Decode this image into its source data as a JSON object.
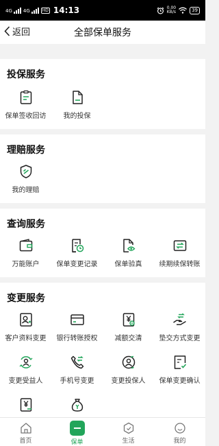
{
  "status_bar": {
    "signal1": "4G",
    "signal2": "4G",
    "hd": "HD",
    "time": "14:13",
    "speed": "0.00",
    "speed_unit": "KB/s",
    "battery": "39"
  },
  "nav": {
    "back_label": "返回",
    "title": "全部保单服务"
  },
  "sections": [
    {
      "title": "投保服务",
      "items": [
        {
          "label": "保单签收回访",
          "icon": "clipboard-icon"
        },
        {
          "label": "我的投保",
          "icon": "document-icon"
        }
      ]
    },
    {
      "title": "理赔服务",
      "items": [
        {
          "label": "我的理赔",
          "icon": "claim-shield-icon"
        }
      ]
    },
    {
      "title": "查询服务",
      "items": [
        {
          "label": "万能账户",
          "icon": "wallet-icon"
        },
        {
          "label": "保单变更记录",
          "icon": "record-clock-icon"
        },
        {
          "label": "保单验真",
          "icon": "verify-eye-icon"
        },
        {
          "label": "续期续保转账",
          "icon": "transfer-icon"
        }
      ]
    },
    {
      "title": "变更服务",
      "items": [
        {
          "label": "客户资料变更",
          "icon": "profile-card-icon"
        },
        {
          "label": "银行转账授权",
          "icon": "bank-card-icon"
        },
        {
          "label": "减额交清",
          "icon": "yen-doc-icon"
        },
        {
          "label": "垫交方式变更",
          "icon": "hand-exchange-icon"
        },
        {
          "label": "变更受益人",
          "icon": "beneficiary-icon"
        },
        {
          "label": "手机号变更",
          "icon": "phone-icon"
        },
        {
          "label": "变更投保人",
          "icon": "policyholder-icon"
        },
        {
          "label": "保单变更确认",
          "icon": "confirm-doc-icon"
        },
        {
          "label": "",
          "icon": "yen-receipt-icon"
        },
        {
          "label": "",
          "icon": "money-bag-icon"
        }
      ]
    }
  ],
  "tabs": [
    {
      "label": "首页",
      "icon": "home-icon"
    },
    {
      "label": "保单",
      "icon": "policy-icon"
    },
    {
      "label": "生活",
      "icon": "life-icon"
    },
    {
      "label": "我的",
      "icon": "smile-icon"
    }
  ],
  "colors": {
    "accent": "#22a55a",
    "text": "#222222",
    "background": "#f2f2f2"
  }
}
